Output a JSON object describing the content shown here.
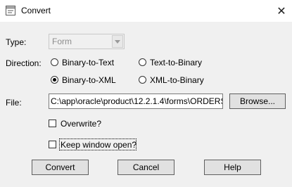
{
  "window": {
    "title": "Convert",
    "close_glyph": "✕",
    "app_icon": "app-icon"
  },
  "type": {
    "label": "Type:",
    "value": "Form"
  },
  "direction": {
    "label": "Direction:",
    "options": [
      {
        "label": "Binary-to-Text",
        "checked": false
      },
      {
        "label": "Text-to-Binary",
        "checked": false
      },
      {
        "label": "Binary-to-XML",
        "checked": true
      },
      {
        "label": "XML-to-Binary",
        "checked": false
      }
    ]
  },
  "file": {
    "label": "File:",
    "value": "C:\\app\\oracle\\product\\12.2.1.4\\forms\\ORDERS"
  },
  "browse_button": "Browse...",
  "overwrite": {
    "label": "Overwrite?",
    "checked": false
  },
  "keep_open": {
    "label": "Keep window open?",
    "checked": false
  },
  "buttons": {
    "convert": "Convert",
    "cancel": "Cancel",
    "help": "Help"
  }
}
